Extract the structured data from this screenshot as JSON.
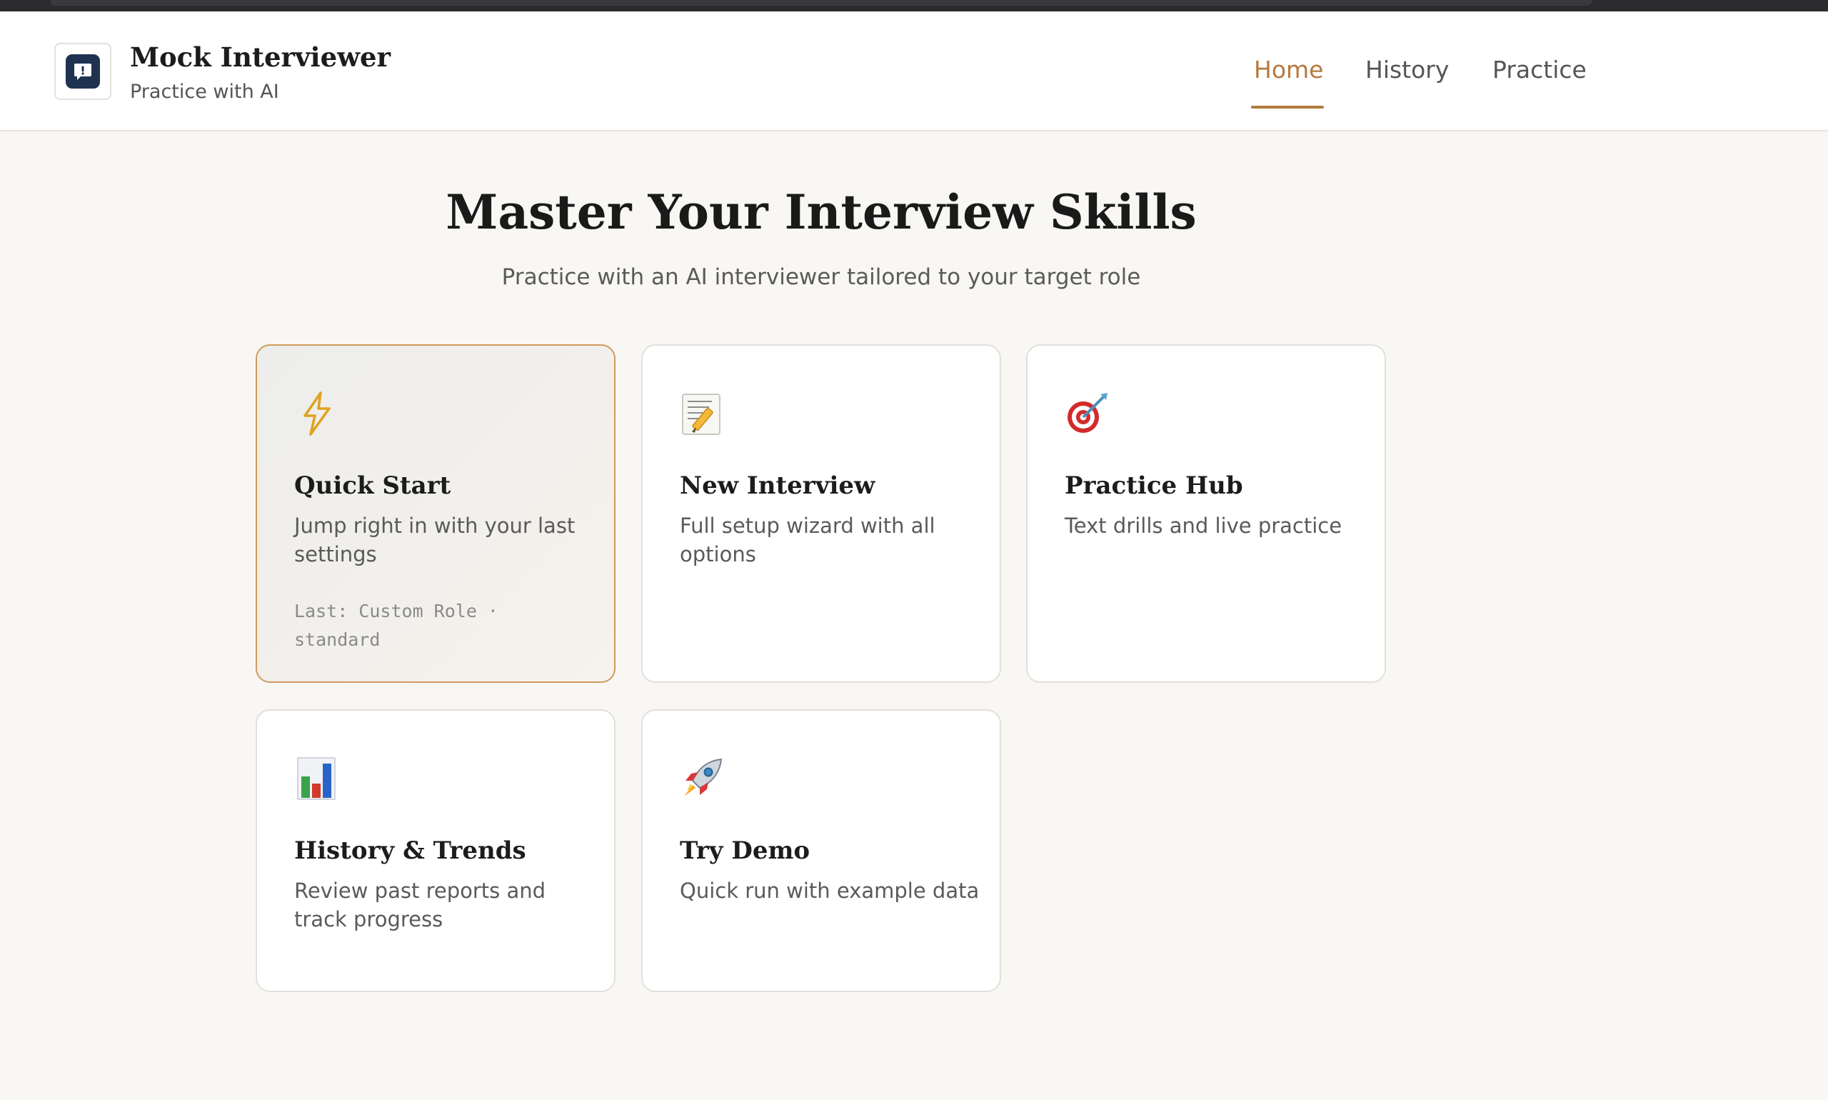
{
  "app": {
    "title": "Mock Interviewer",
    "subtitle": "Practice with AI",
    "logo_icon": "chat-bubble-icon",
    "brand_color": "#1f3250",
    "accent_color": "#b57a3c"
  },
  "nav": {
    "items": [
      {
        "label": "Home",
        "active": true
      },
      {
        "label": "History",
        "active": false
      },
      {
        "label": "Practice",
        "active": false
      }
    ]
  },
  "hero": {
    "title": "Master Your Interview Skills",
    "subtitle": "Practice with an AI interviewer tailored to your target role"
  },
  "cards": [
    {
      "icon": "lightning-icon",
      "title": "Quick Start",
      "desc": "Jump right in with your last settings",
      "meta": "Last: Custom Role · standard",
      "featured": true
    },
    {
      "icon": "memo-icon",
      "title": "New Interview",
      "desc": "Full setup wizard with all options"
    },
    {
      "icon": "target-icon",
      "title": "Practice Hub",
      "desc": "Text drills and live practice"
    },
    {
      "icon": "bar-chart-icon",
      "title": "History & Trends",
      "desc": "Review past reports and track progress"
    },
    {
      "icon": "rocket-icon",
      "title": "Try Demo",
      "desc": "Quick run with example data"
    }
  ]
}
